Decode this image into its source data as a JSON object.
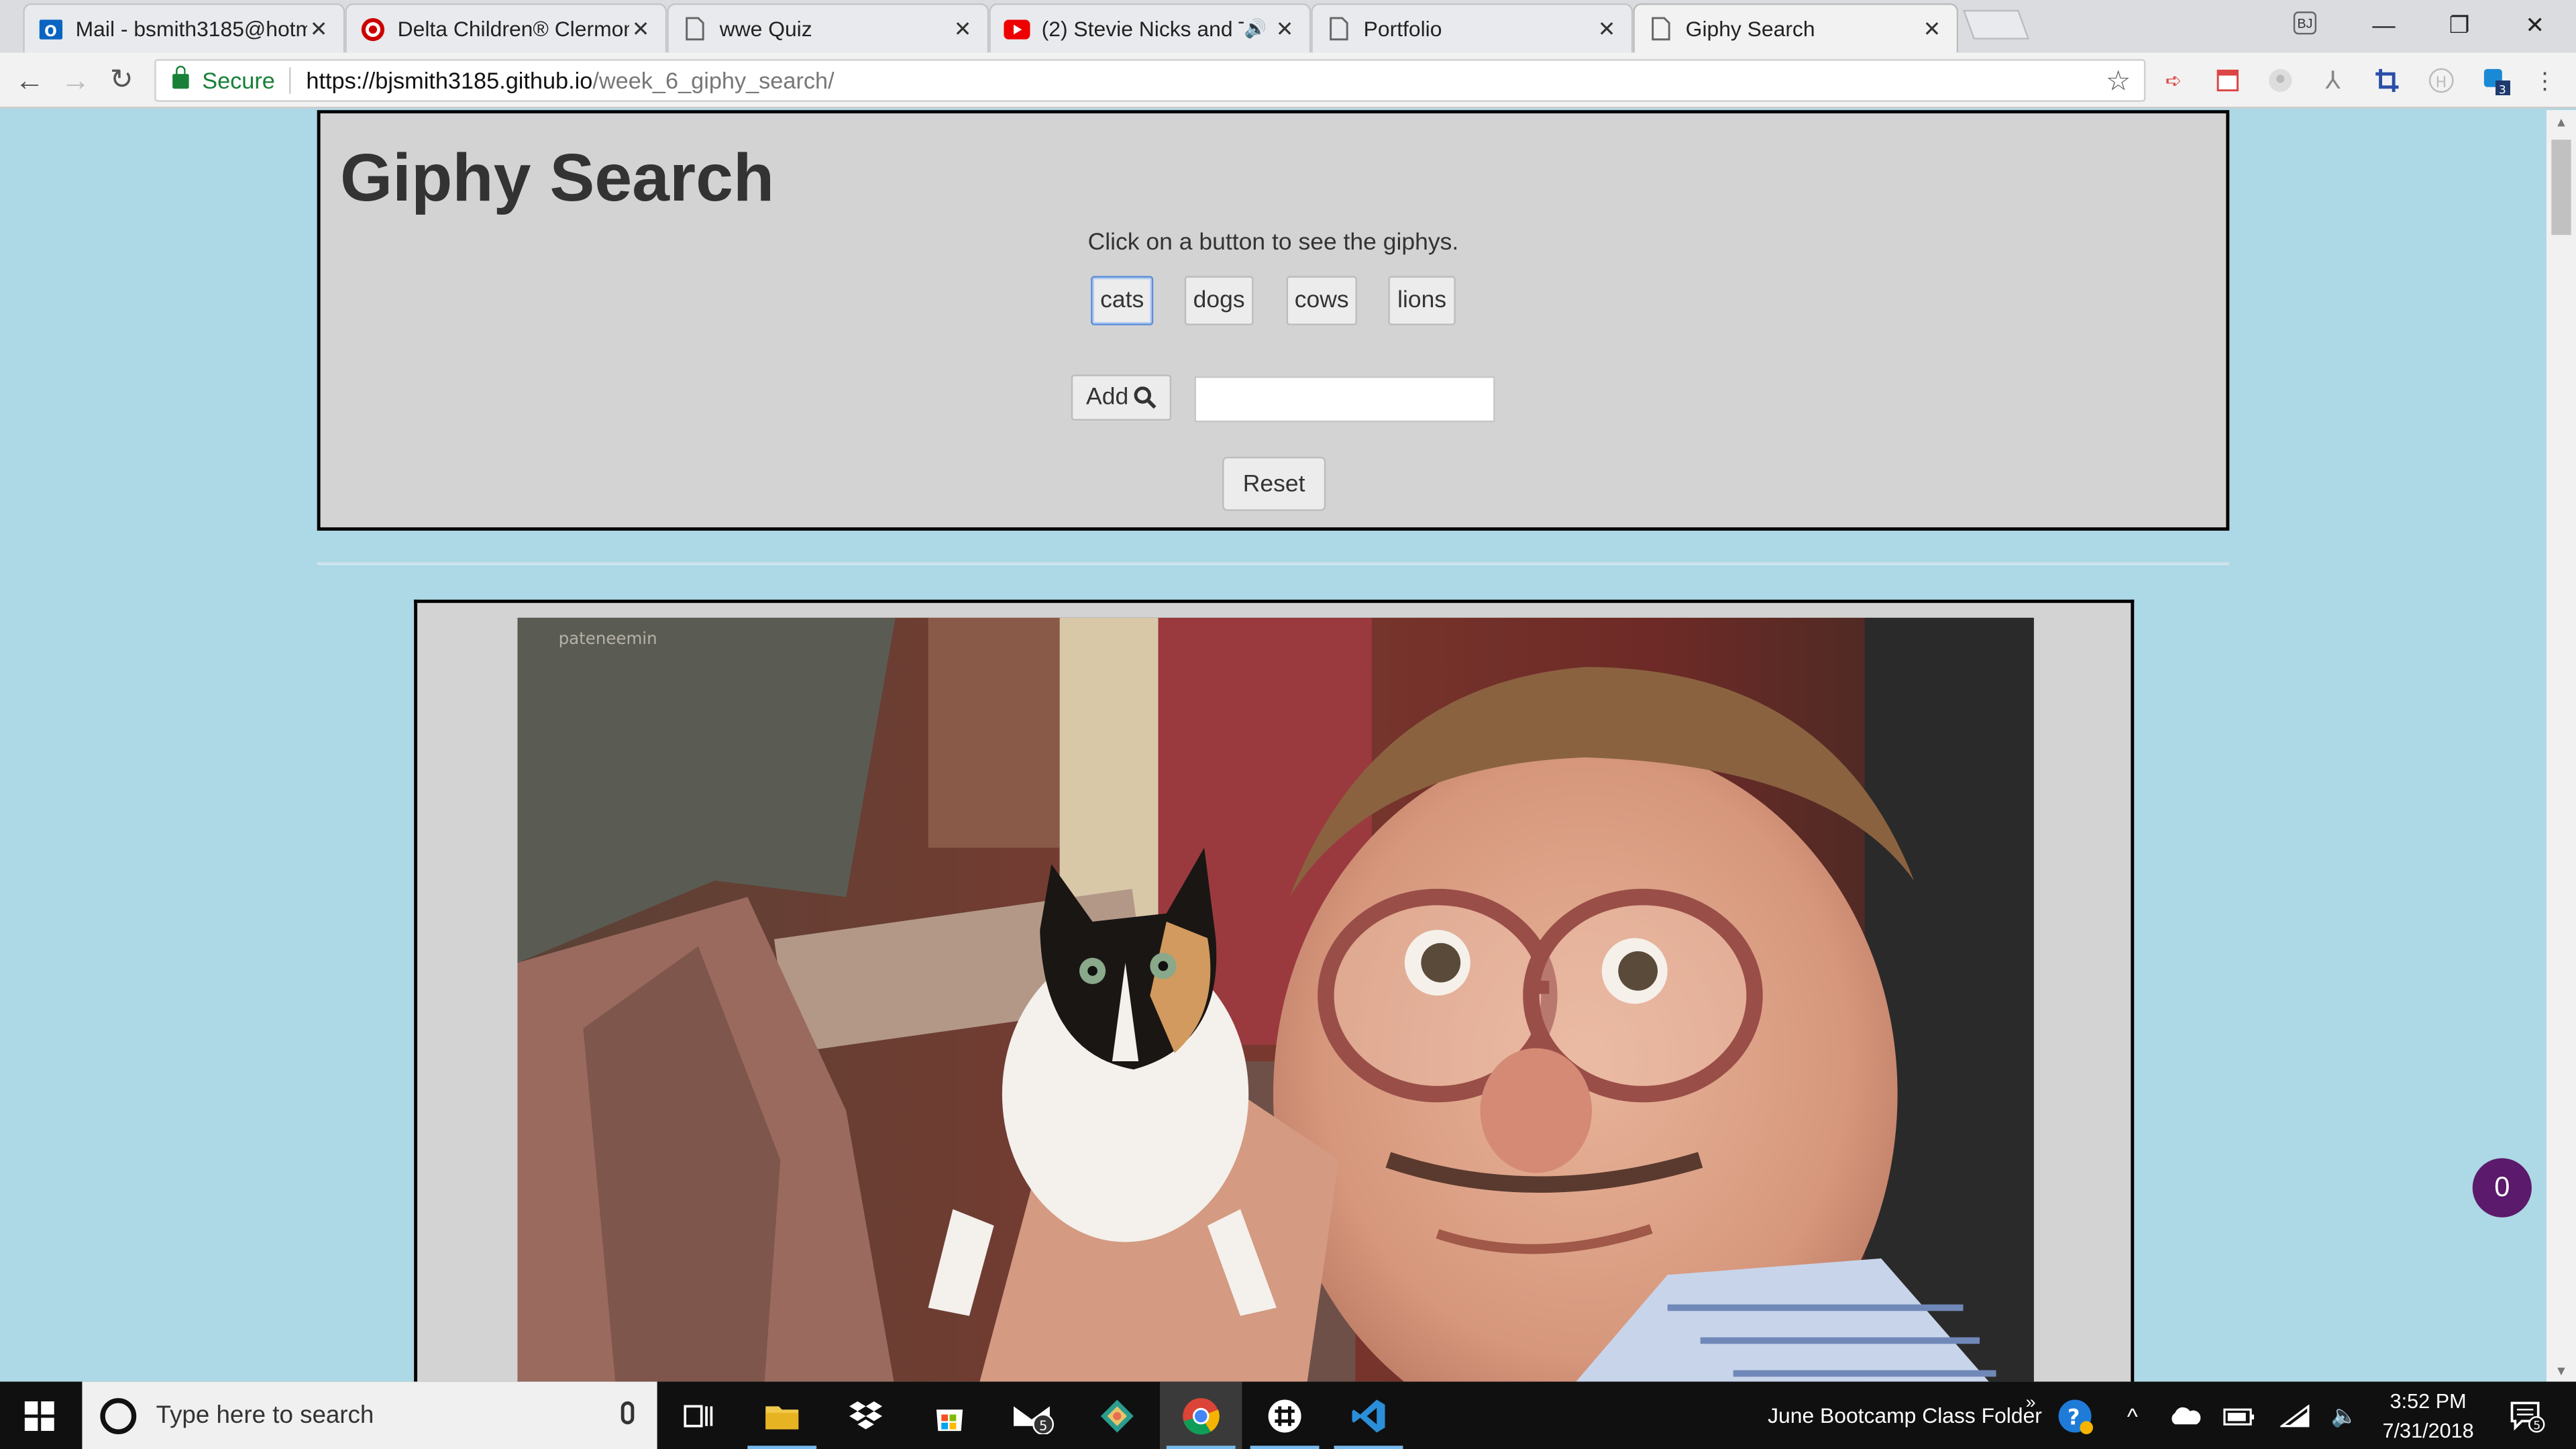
{
  "browser": {
    "tabs": [
      {
        "title": "Mail - bsmith3185@hotm",
        "icon": "outlook-icon"
      },
      {
        "title": "Delta Children® Clermon",
        "icon": "target-icon"
      },
      {
        "title": "wwe Quiz",
        "icon": "page-icon"
      },
      {
        "title": "(2) Stevie Nicks and To",
        "icon": "youtube-icon"
      },
      {
        "title": "Portfolio",
        "icon": "page-icon"
      },
      {
        "title": "Giphy Search",
        "icon": "page-icon"
      }
    ],
    "active_tab": 5,
    "profile_label": "BJ",
    "secure_label": "Secure",
    "url_scheme_host": "https://bjsmith3185.github.io",
    "url_path": "/week_6_giphy_search/",
    "extension_badge": "3"
  },
  "page": {
    "title": "Giphy Search",
    "instructions": "Click on a button to see the giphys.",
    "topic_buttons": [
      "cats",
      "dogs",
      "cows",
      "lions"
    ],
    "add_label": "Add",
    "add_input_value": "",
    "reset_label": "Reset",
    "gif_watermark": "pateneemin",
    "counter": "0"
  },
  "taskbar": {
    "search_placeholder": "Type here to search",
    "folder_label": "June Bootcamp Class Folder",
    "time": "3:52 PM",
    "date": "7/31/2018",
    "mail_badge": "5",
    "notification_badge": "5"
  },
  "colors": {
    "page_bg": "#add8e6",
    "panel_bg": "#d3d3d3",
    "counter_bg": "#5b1a6b",
    "secure_green": "#188038"
  }
}
